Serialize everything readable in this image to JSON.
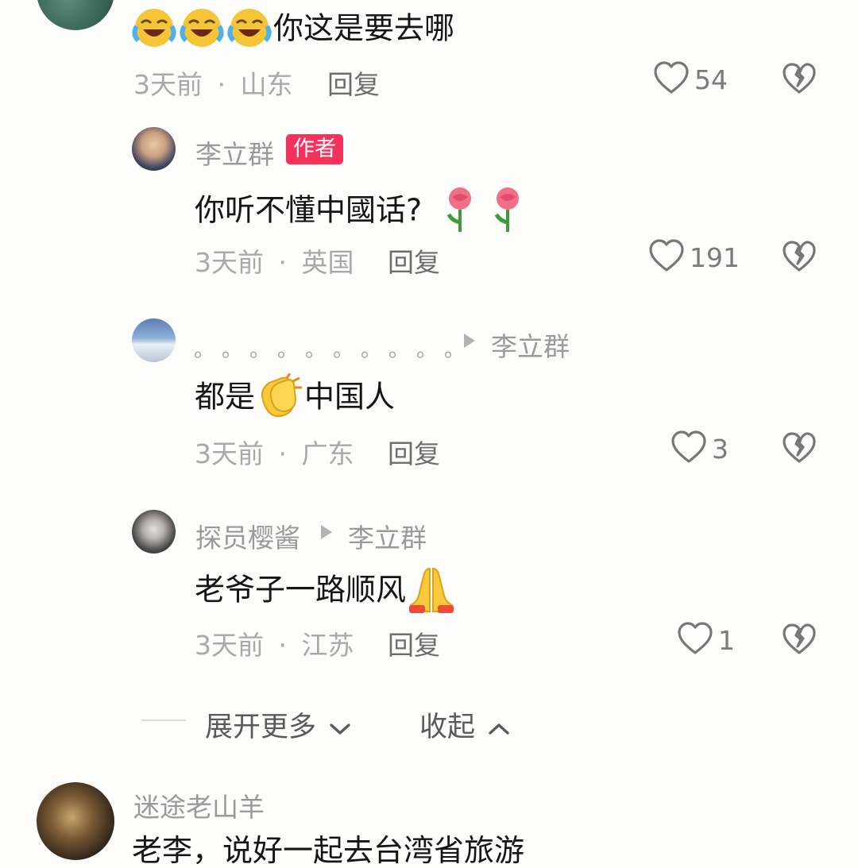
{
  "comments": [
    {
      "content": "你这是要去哪",
      "time": "3天前",
      "sep": "·",
      "location": "山东",
      "reply_label": "回复",
      "likes": "54"
    }
  ],
  "replies": [
    {
      "username": "李立群",
      "badge": "作者",
      "content": "你听不懂中國话?",
      "time": "3天前",
      "sep": "·",
      "location": "英国",
      "reply_label": "回复",
      "likes": "191"
    },
    {
      "username": "。。。。。。。。。。",
      "reply_to": "李立群",
      "content_before": "都是",
      "content_after": "中国人",
      "time": "3天前",
      "sep": "·",
      "location": "广东",
      "reply_label": "回复",
      "likes": "3"
    },
    {
      "username": "探员樱酱",
      "reply_to": "李立群",
      "content": "老爷子一路顺风",
      "time": "3天前",
      "sep": "·",
      "location": "江苏",
      "reply_label": "回复",
      "likes": "1"
    }
  ],
  "controls": {
    "expand_label": "展开更多",
    "collapse_label": "收起"
  },
  "next_comment": {
    "username": "迷途老山羊",
    "content_partial": "老李，说好一起去台湾省旅游"
  },
  "icons": {
    "like": "heart-outline-icon",
    "dislike": "broken-heart-icon",
    "expand": "chevron-down-icon",
    "collapse": "chevron-up-icon"
  },
  "colors": {
    "badge": "#f5325c",
    "meta_text": "#a9a9a9",
    "body_text": "#161616"
  }
}
